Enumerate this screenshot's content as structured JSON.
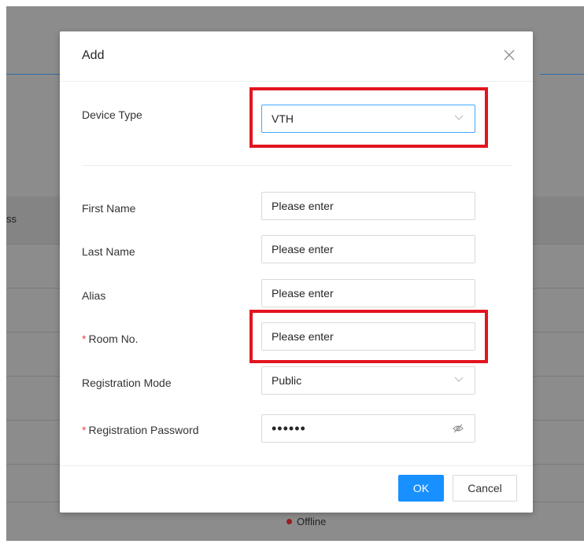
{
  "background": {
    "column_fragment": "ss",
    "status_text": "Offline"
  },
  "modal": {
    "title": "Add",
    "close_icon": "close-icon",
    "device_type": {
      "label": "Device Type",
      "value": "VTH"
    },
    "first_name": {
      "label": "First Name",
      "placeholder": "Please enter"
    },
    "last_name": {
      "label": "Last Name",
      "placeholder": "Please enter"
    },
    "alias": {
      "label": "Alias",
      "placeholder": "Please enter"
    },
    "room_no": {
      "required_mark": "*",
      "label": "Room No.",
      "placeholder": "Please enter"
    },
    "registration_mode": {
      "label": "Registration Mode",
      "value": "Public"
    },
    "registration_password": {
      "required_mark": "*",
      "label": "Registration Password",
      "value": "••••••",
      "toggle_icon": "eye-off-icon"
    },
    "ok_label": "OK",
    "cancel_label": "Cancel"
  },
  "colors": {
    "primary": "#1890ff",
    "highlight": "#e3141f",
    "required": "#e14b4b",
    "offline": "#9b1c1c"
  }
}
